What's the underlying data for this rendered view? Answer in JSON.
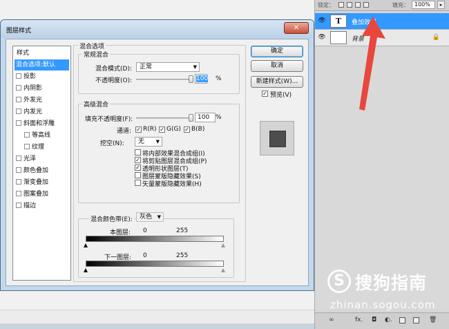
{
  "layers_panel": {
    "topbar": {
      "lock_label": "锁定：",
      "fill_label": "填充：",
      "fill_value": "100%",
      "arrow": "▸"
    },
    "layers": [
      {
        "name": "叠加效果",
        "thumb": "T",
        "eye": "👁",
        "selected": true
      },
      {
        "name": "背景",
        "thumb": "",
        "eye": "👁",
        "lock": "🔒"
      }
    ],
    "bottom_icons": [
      "∞",
      "fx.",
      "◘",
      "◐.",
      "▭",
      "▭",
      "🗑"
    ]
  },
  "dialog": {
    "title": "图层样式",
    "close_symbol": "✕",
    "style_list": [
      {
        "label": "样式",
        "kind": "header"
      },
      {
        "label": "混合选项:默认",
        "kind": "active"
      },
      {
        "label": "投影",
        "kind": "item"
      },
      {
        "label": "内阴影",
        "kind": "item"
      },
      {
        "label": "外发光",
        "kind": "item"
      },
      {
        "label": "内发光",
        "kind": "item"
      },
      {
        "label": "斜面和浮雕",
        "kind": "item"
      },
      {
        "label": "等高线",
        "kind": "sub"
      },
      {
        "label": "纹理",
        "kind": "sub"
      },
      {
        "label": "光泽",
        "kind": "item"
      },
      {
        "label": "颜色叠加",
        "kind": "item"
      },
      {
        "label": "渐变叠加",
        "kind": "item"
      },
      {
        "label": "图案叠加",
        "kind": "item"
      },
      {
        "label": "描边",
        "kind": "item"
      }
    ],
    "blending_options": {
      "title": "混合选项",
      "general": {
        "title": "常规混合",
        "blend_mode_label": "混合模式(D):",
        "blend_mode_value": "正常",
        "opacity_label": "不透明度(O):",
        "opacity_value": "100",
        "percent": "%"
      },
      "advanced": {
        "title": "高级混合",
        "fill_opacity_label": "填充不透明度(F):",
        "fill_opacity_value": "100",
        "percent": "%",
        "channels_label": "通道:",
        "channels": [
          "R(R)",
          "G(G)",
          "B(B)"
        ],
        "knockout_label": "挖空(N):",
        "knockout_value": "无",
        "options": [
          {
            "label": "将内部效果混合成组(I)",
            "checked": false
          },
          {
            "label": "将剪贴图层混合成组(P)",
            "checked": true
          },
          {
            "label": "透明形状图层(T)",
            "checked": true
          },
          {
            "label": "图层蒙版隐藏效果(S)",
            "checked": false
          },
          {
            "label": "矢量蒙版隐藏效果(H)",
            "checked": false
          }
        ]
      },
      "blend_if": {
        "label": "混合颜色带(E):",
        "value": "灰色",
        "this_layer_label": "本图层:",
        "underlying_label": "下一图层:",
        "min": "0",
        "max": "255"
      }
    },
    "buttons": {
      "ok": "确定",
      "cancel": "取消",
      "new_style": "新建样式(W)...",
      "preview_label": "预览(V)",
      "preview_checked": true
    }
  },
  "watermark": {
    "glyph": "S",
    "text_cn": "搜狗指南",
    "url": "zhinan.sogou.com"
  },
  "colors": {
    "selection": "#3399ff",
    "arrow": "#e8473d"
  }
}
